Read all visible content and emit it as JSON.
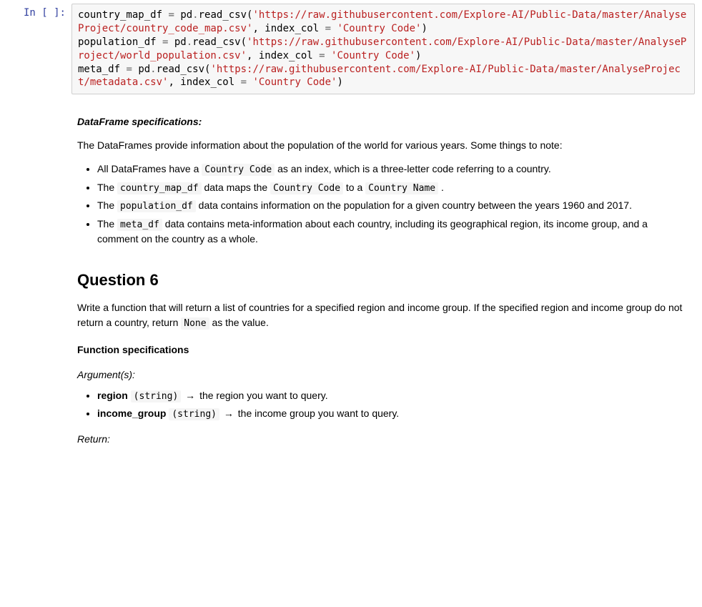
{
  "cell1": {
    "prompt": "In [ ]:",
    "code": {
      "v1": "country_map_df",
      "eq": " = ",
      "pd": "pd",
      "dot": ".",
      "rc": "read_csv",
      "op": "(",
      "url1": "'https://raw.githubusercontent.com/Explore-AI/Public-Data/master/AnalyseProject/country_code_map.csv'",
      "comma": ", ",
      "idx": "index_col",
      "cc": "'Country Code'",
      "cp": ")",
      "v2": "population_df",
      "url2": "'https://raw.githubusercontent.com/Explore-AI/Public-Data/master/AnalyseProject/world_population.csv'",
      "v3": "meta_df",
      "url3": "'https://raw.githubusercontent.com/Explore-AI/Public-Data/master/AnalyseProject/metadata.csv'"
    }
  },
  "md": {
    "spec_heading": "DataFrame specifications:",
    "intro": "The DataFrames provide information about the population of the world for various years. Some things to note:",
    "b1_a": "All DataFrames have a ",
    "b1_code": "Country Code",
    "b1_b": " as an index, which is a three-letter code referring to a country.",
    "b2_a": "The ",
    "b2_code1": "country_map_df",
    "b2_b": " data maps the ",
    "b2_code2": "Country Code",
    "b2_c": " to a ",
    "b2_code3": "Country Name",
    "b2_d": " .",
    "b3_a": "The ",
    "b3_code": "population_df",
    "b3_b": " data contains information on the population for a given country between the years 1960 and 2017.",
    "b4_a": "The ",
    "b4_code": "meta_df",
    "b4_b": " data contains meta-information about each country, including its geographical region, its income group, and a comment on the country as a whole.",
    "q_heading": "Question 6",
    "q_p_a": "Write a function that will return a list of countries for a specified region and income group. If the specified region and income group do not return a country, return ",
    "q_p_code": "None",
    "q_p_b": " as the value.",
    "fspec": "Function specifications",
    "args": "Argument(s):",
    "arg1_name": "region",
    "arg1_type": "(string)",
    "arrow": " → ",
    "arg1_desc": "the region you want to query.",
    "arg2_name": "income_group",
    "arg2_type": "(string)",
    "arg2_desc": "the income group you want to query.",
    "ret": "Return:"
  }
}
